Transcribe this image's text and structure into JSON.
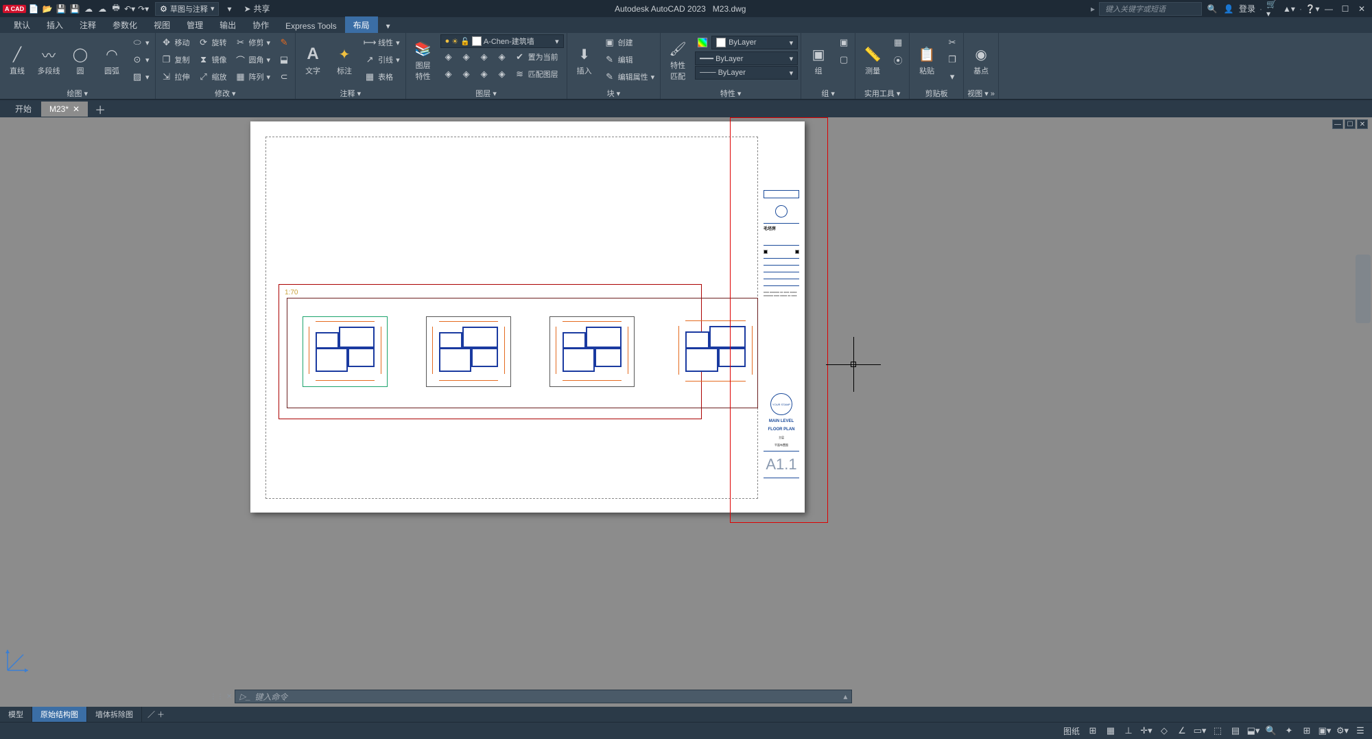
{
  "title": {
    "app": "Autodesk AutoCAD 2023",
    "file": "M23.dwg",
    "logo": "A CAD"
  },
  "qat": {
    "workspace": "草图与注释",
    "share": "共享"
  },
  "search": {
    "placeholder": "键入关键字或短语",
    "login": "登录"
  },
  "tabs": [
    "默认",
    "插入",
    "注释",
    "参数化",
    "视图",
    "管理",
    "输出",
    "协作",
    "Express Tools",
    "布局",
    "▾"
  ],
  "active_tab_index": 9,
  "ribbon": {
    "draw": {
      "label": "绘图 ▾",
      "line": "直线",
      "polyline": "多段线",
      "circle": "圆",
      "arc": "圆弧"
    },
    "modify": {
      "label": "修改 ▾",
      "move": "移动",
      "rotate": "旋转",
      "trim": "修剪",
      "copy": "复制",
      "mirror": "镜像",
      "fillet": "圆角",
      "stretch": "拉伸",
      "scale": "缩放",
      "array": "阵列"
    },
    "annotate": {
      "label": "注释 ▾",
      "text": "文字",
      "dim": "标注",
      "table": "表格",
      "linear": "线性",
      "leader": "引线"
    },
    "layers": {
      "label": "图层 ▾",
      "props": "图层\n特性",
      "current_layer": "A-Chen-建筑墙",
      "setcurrent": "置为当前",
      "match": "匹配图层"
    },
    "block": {
      "label": "块 ▾",
      "insert": "插入",
      "create": "创建",
      "edit": "编辑",
      "editattr": "编辑属性"
    },
    "props": {
      "label": "特性 ▾",
      "match": "特性\n匹配",
      "layer": "ByLayer",
      "linetype": "ByLayer",
      "lineweight": "ByLayer"
    },
    "group": {
      "label": "组 ▾",
      "group": "组"
    },
    "utils": {
      "label": "实用工具 ▾",
      "measure": "测量"
    },
    "clip": {
      "label": "剪贴板",
      "paste": "粘贴"
    },
    "view": {
      "label": "视图 ▾ »",
      "base": "基点"
    }
  },
  "filetabs": {
    "start": "开始",
    "current": "M23*"
  },
  "viewport": {
    "scale_label": "1:70"
  },
  "titleblock": {
    "project_label": "毛坯房",
    "plan_title1": "MAIN LEVEL",
    "plan_title2": "FLOOR PLAN",
    "plan_cn1": "主层",
    "plan_cn2": "平面布置图",
    "stamp": "YOUR STAMP",
    "sheet": "A1.1"
  },
  "cmd": {
    "placeholder": "键入命令"
  },
  "layouttabs": {
    "model": "模型",
    "l1": "原始结构图",
    "l2": "墙体拆除图"
  },
  "status": {
    "paper": "图纸"
  }
}
